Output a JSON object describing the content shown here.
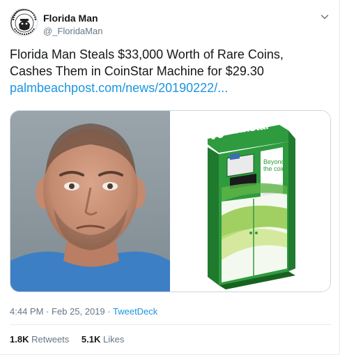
{
  "author": {
    "display_name": "Florida Man",
    "handle": "@_FloridaMan",
    "avatar_text_top": "FLORIDA MAN",
    "avatar_text_bottom": "DEEP STATE"
  },
  "tweet": {
    "text_line_1": "Florida Man Steals $33,000 Worth of Rare Coins,",
    "text_line_2": "Cashes Them in CoinStar Machine for $29.30",
    "link": "palmbeachpost.com/news/20190222/..."
  },
  "media": {
    "left_icon": "mugshot-photo",
    "right_icon": "coinstar-kiosk-photo",
    "kiosk_brand": "coinstar",
    "kiosk_slogan_1": "Beyond",
    "kiosk_slogan_2": "the coin"
  },
  "meta": {
    "time": "4:44 PM",
    "separator": "·",
    "date": "Feb 25, 2019",
    "source": "TweetDeck"
  },
  "stats": {
    "retweets_count": "1.8K",
    "retweets_label": "Retweets",
    "likes_count": "5.1K",
    "likes_label": "Likes"
  },
  "colors": {
    "link": "#1b95e0",
    "muted": "#657786",
    "text": "#14171a",
    "coinstar_green": "#2e9b3e"
  }
}
